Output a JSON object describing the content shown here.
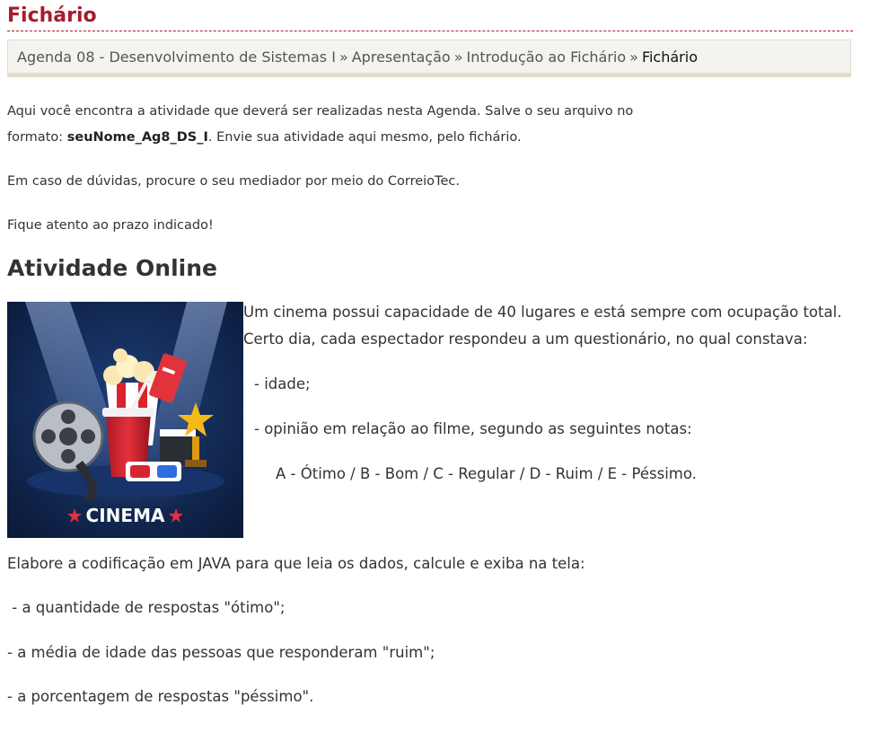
{
  "page": {
    "title": "Fichário"
  },
  "breadcrumb": {
    "items": [
      "Agenda 08 - Desenvolvimento de Sistemas I",
      "Apresentação",
      "Introdução ao Fichário"
    ],
    "separator": "»",
    "current": "Fichário"
  },
  "intro": {
    "line1": "Aqui você encontra a atividade que deverá ser realizadas nesta Agenda. Salve o seu arquivo no",
    "line2_prefix": "formato: ",
    "line2_filename": "seuNome_Ag8_DS_I",
    "line2_suffix": ". Envie sua atividade aqui mesmo, pelo fichário.",
    "doubts": "Em caso de dúvidas, procure o seu mediador por meio do CorreioTec.",
    "deadline": "Fique atento ao prazo indicado!"
  },
  "activity": {
    "heading": "Atividade Online",
    "image_label": "CINEMA",
    "statement_1": "Um cinema possui capacidade de 40 lugares e está sempre com ocupação total.",
    "statement_2": "Certo dia, cada espectador respondeu a um questionário, no qual constava:",
    "item_age": "- idade;",
    "item_opinion": "- opinião em relação ao filme, segundo as seguintes notas:",
    "grades": "A - Ótimo /  B - Bom / C - Regular  / D - Ruim  / E -  Péssimo.",
    "task": "Elabore a codificação em JAVA para que leia os dados, calcule e exiba na tela:",
    "req_1": " - a quantidade de respostas \"ótimo\";",
    "req_2": "- a média de idade das pessoas que responderam \"ruim\";",
    "req_3": "- a porcentagem de respostas \"péssimo\"."
  },
  "colors": {
    "title": "#a51c2b",
    "text": "#333333",
    "breadcrumb_bg": "#f5f3ef",
    "poster_bg": "#0f2347"
  }
}
